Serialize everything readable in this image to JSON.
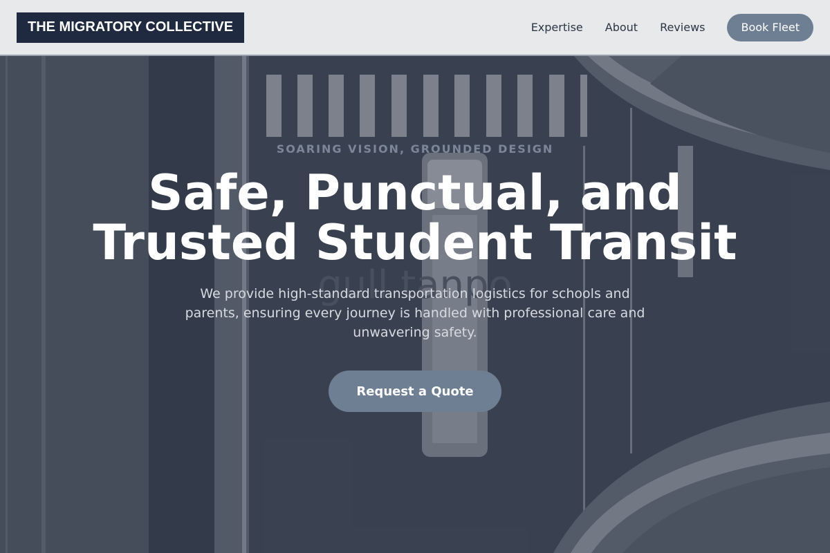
{
  "header": {
    "logo_text": "THE MIGRATORY COLLECTIVE",
    "nav": [
      {
        "label": "Expertise"
      },
      {
        "label": "About"
      },
      {
        "label": "Reviews"
      }
    ],
    "cta_label": "Book Fleet"
  },
  "hero": {
    "eyebrow": "SOARING VISION, GROUNDED DESIGN",
    "headline_line1": "Safe, Punctual, and",
    "headline_line2": "Trusted Student Transit",
    "subtext": "We provide high-standard transportation logistics for schools and parents, ensuring every journey is handled with professional care and unwavering safety.",
    "cta_label": "Request a Quote",
    "background_label": "gull tanpo"
  },
  "colors": {
    "logo_bg": "#1f2a40",
    "button_bg": "#6f7f93",
    "header_bg": "#e8e9eb",
    "eyebrow": "#7b8799"
  }
}
